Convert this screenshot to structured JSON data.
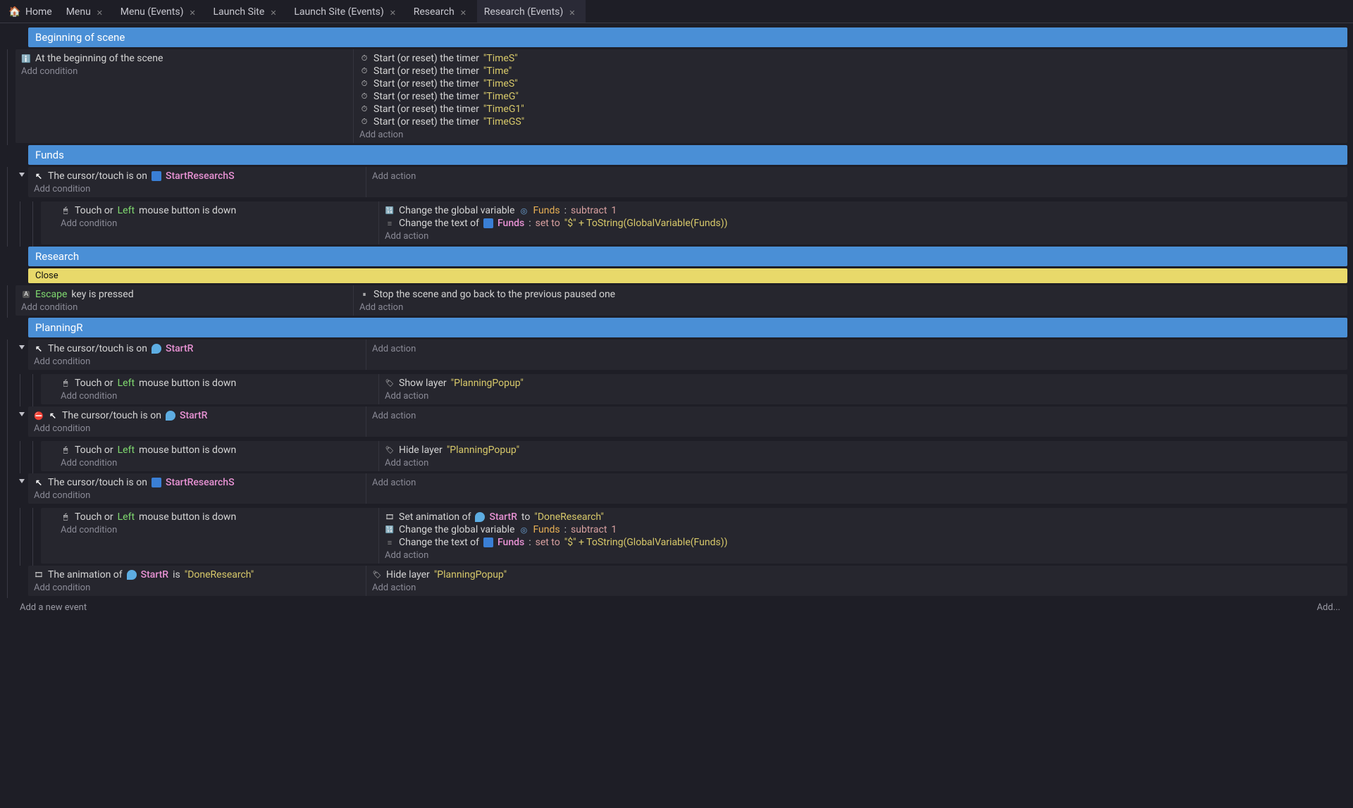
{
  "tabs": [
    {
      "label": "Home",
      "closable": false,
      "home": true
    },
    {
      "label": "Menu",
      "closable": true
    },
    {
      "label": "Menu (Events)",
      "closable": true
    },
    {
      "label": "Launch Site",
      "closable": true
    },
    {
      "label": "Launch Site (Events)",
      "closable": true
    },
    {
      "label": "Research",
      "closable": true
    },
    {
      "label": "Research (Events)",
      "closable": true,
      "active": true
    }
  ],
  "labels": {
    "add_condition": "Add condition",
    "add_action": "Add action",
    "add_event": "Add a new event",
    "add_dots": "Add..."
  },
  "groups": {
    "g1": "Beginning of scene",
    "g2": "Funds",
    "g3": "Research",
    "g4": "PlanningR"
  },
  "comment": {
    "close": "Close"
  },
  "cond": {
    "atBeginning": "At the beginning of the scene",
    "cursorOn": "The cursor/touch is on",
    "touchOr": "Touch or",
    "left": "Left",
    "mouseDown": "mouse button is down",
    "escape": "Escape",
    "keyPressed": "key is pressed",
    "animOf": "The animation of",
    "is": "is"
  },
  "act": {
    "startTimer": "Start (or reset) the timer",
    "changeGlobal": "Change the global variable",
    "changeText": "Change the text of",
    "stopScene": "Stop the scene and go back to the previous paused one",
    "showLayer": "Show layer",
    "hideLayer": "Hide layer",
    "setAnim": "Set animation of",
    "to": "to",
    "setTo": "set to",
    "subtract": "subtract"
  },
  "objs": {
    "startResearchS": "StartResearchS",
    "funds": "Funds",
    "startR": "StartR"
  },
  "vals": {
    "timeS": "\"TimeS\"",
    "time": "\"Time\"",
    "timeSu": "\"TimeS\"",
    "timeG": "\"TimeG\"",
    "timeG1": "\"TimeG1\"",
    "timeGS": "\"TimeGS\"",
    "one": "1",
    "colon": ":",
    "fundsExpr": "\"$\" + ToString(GlobalVariable(Funds))",
    "planningPopup": "\"PlanningPopup\"",
    "doneResearch": "\"DoneResearch\""
  }
}
